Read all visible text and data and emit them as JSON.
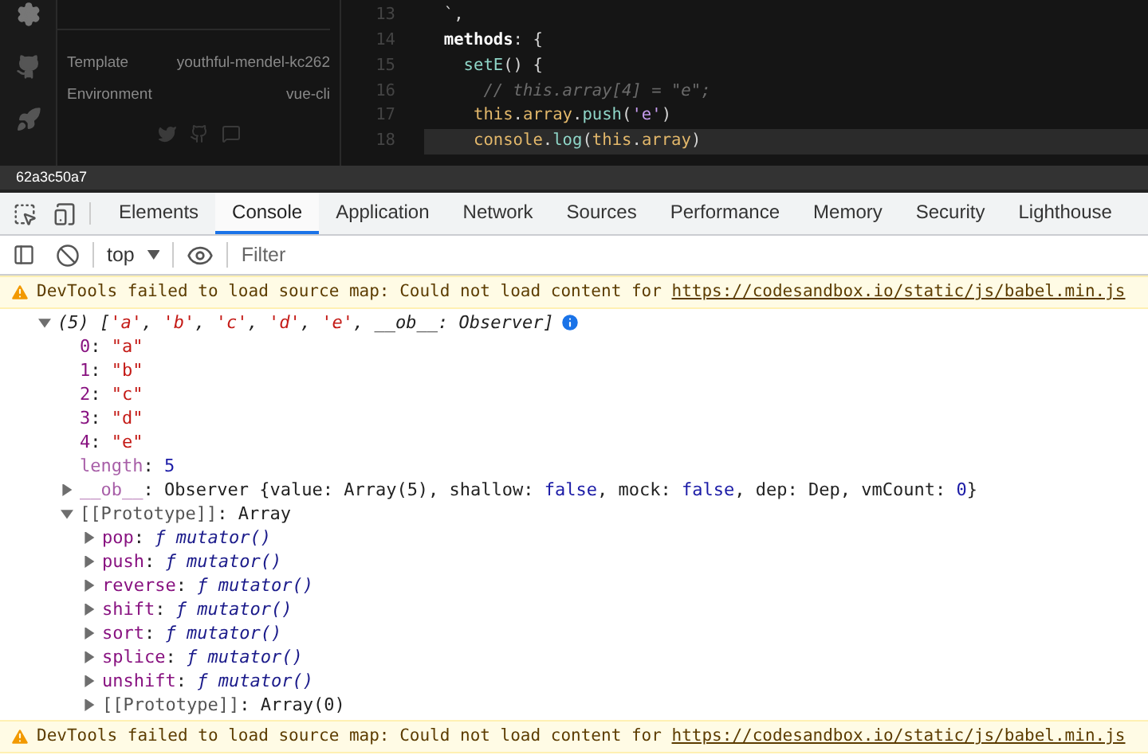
{
  "sidebar": {
    "info": [
      {
        "label": "Template",
        "value": "youthful-mendel-kc262"
      },
      {
        "label": "Environment",
        "value": "vue-cli"
      }
    ]
  },
  "editor": {
    "lines": [
      {
        "number": "13",
        "current": false,
        "tokens": [
          {
            "kind": "punct",
            "text": "  `,"
          }
        ]
      },
      {
        "number": "14",
        "current": false,
        "tokens": [
          {
            "kind": "key",
            "text": "  methods"
          },
          {
            "kind": "punct",
            "text": ": {"
          }
        ]
      },
      {
        "number": "15",
        "current": false,
        "tokens": [
          {
            "kind": "fn",
            "text": "    setE"
          },
          {
            "kind": "punct",
            "text": "() {"
          }
        ]
      },
      {
        "number": "16",
        "current": false,
        "tokens": [
          {
            "kind": "comment",
            "text": "      // this.array[4] = \"e\";"
          }
        ]
      },
      {
        "number": "17",
        "current": false,
        "tokens": [
          {
            "kind": "this",
            "text": "     this"
          },
          {
            "kind": "punct",
            "text": "."
          },
          {
            "kind": "this",
            "text": "array"
          },
          {
            "kind": "punct",
            "text": "."
          },
          {
            "kind": "fn",
            "text": "push"
          },
          {
            "kind": "punct",
            "text": "("
          },
          {
            "kind": "str",
            "text": "'e'"
          },
          {
            "kind": "punct",
            "text": ")"
          }
        ]
      },
      {
        "number": "18",
        "current": true,
        "tokens": [
          {
            "kind": "this",
            "text": "     console"
          },
          {
            "kind": "punct",
            "text": "."
          },
          {
            "kind": "fn",
            "text": "log"
          },
          {
            "kind": "punct",
            "text": "("
          },
          {
            "kind": "this",
            "text": "this"
          },
          {
            "kind": "punct",
            "text": "."
          },
          {
            "kind": "this",
            "text": "array"
          },
          {
            "kind": "punct",
            "text": ")"
          }
        ]
      }
    ]
  },
  "status_bar": {
    "commit": "62a3c50a7"
  },
  "devtools": {
    "tabs": [
      {
        "label": "Elements",
        "selected": false
      },
      {
        "label": "Console",
        "selected": true
      },
      {
        "label": "Application",
        "selected": false
      },
      {
        "label": "Network",
        "selected": false
      },
      {
        "label": "Sources",
        "selected": false
      },
      {
        "label": "Performance",
        "selected": false
      },
      {
        "label": "Memory",
        "selected": false
      },
      {
        "label": "Security",
        "selected": false
      },
      {
        "label": "Lighthouse",
        "selected": false
      }
    ],
    "context": "top",
    "filter": {
      "placeholder": "Filter"
    }
  },
  "console": [
    {
      "kind": "warning",
      "text": "DevTools failed to load source map: Could not load content for ",
      "link": "https://codesandbox.io/static/js/babel.min.js"
    },
    {
      "kind": "tree",
      "root": {
        "expanded": true,
        "info": true,
        "tokens": [
          {
            "kind": "prev",
            "text": "(5) ["
          },
          {
            "kind": "prevstr",
            "text": "'a'"
          },
          {
            "kind": "prev",
            "text": ", "
          },
          {
            "kind": "prevstr",
            "text": "'b'"
          },
          {
            "kind": "prev",
            "text": ", "
          },
          {
            "kind": "prevstr",
            "text": "'c'"
          },
          {
            "kind": "prev",
            "text": ", "
          },
          {
            "kind": "prevstr",
            "text": "'d'"
          },
          {
            "kind": "prev",
            "text": ", "
          },
          {
            "kind": "prevstr",
            "text": "'e'"
          },
          {
            "kind": "prev",
            "text": ", __ob__: Observer]"
          }
        ],
        "children": [
          {
            "tokens": [
              {
                "kind": "name",
                "text": "0"
              },
              {
                "kind": "plain",
                "text": ": "
              },
              {
                "kind": "str",
                "text": "\"a\""
              }
            ]
          },
          {
            "tokens": [
              {
                "kind": "name",
                "text": "1"
              },
              {
                "kind": "plain",
                "text": ": "
              },
              {
                "kind": "str",
                "text": "\"b\""
              }
            ]
          },
          {
            "tokens": [
              {
                "kind": "name",
                "text": "2"
              },
              {
                "kind": "plain",
                "text": ": "
              },
              {
                "kind": "str",
                "text": "\"c\""
              }
            ]
          },
          {
            "tokens": [
              {
                "kind": "name",
                "text": "3"
              },
              {
                "kind": "plain",
                "text": ": "
              },
              {
                "kind": "str",
                "text": "\"d\""
              }
            ]
          },
          {
            "tokens": [
              {
                "kind": "name",
                "text": "4"
              },
              {
                "kind": "plain",
                "text": ": "
              },
              {
                "kind": "str",
                "text": "\"e\""
              }
            ]
          },
          {
            "tokens": [
              {
                "kind": "dimname",
                "text": "length"
              },
              {
                "kind": "plain",
                "text": ": "
              },
              {
                "kind": "num",
                "text": "5"
              }
            ]
          },
          {
            "expanded": false,
            "tokens": [
              {
                "kind": "dimname",
                "text": "__ob__"
              },
              {
                "kind": "plain",
                "text": ": Observer {value: Array(5), shallow: "
              },
              {
                "kind": "num",
                "text": "false"
              },
              {
                "kind": "plain",
                "text": ", mock: "
              },
              {
                "kind": "num",
                "text": "false"
              },
              {
                "kind": "plain",
                "text": ", dep: Dep, vmCount: "
              },
              {
                "kind": "num",
                "text": "0"
              },
              {
                "kind": "plain",
                "text": "}"
              }
            ]
          },
          {
            "expanded": true,
            "tokens": [
              {
                "kind": "gray",
                "text": "[[Prototype]]"
              },
              {
                "kind": "plain",
                "text": ": Array"
              }
            ],
            "children": [
              {
                "expanded": false,
                "tokens": [
                  {
                    "kind": "name",
                    "text": "pop"
                  },
                  {
                    "kind": "plain",
                    "text": ": "
                  },
                  {
                    "kind": "fn",
                    "text": "ƒ mutator()"
                  }
                ]
              },
              {
                "expanded": false,
                "tokens": [
                  {
                    "kind": "name",
                    "text": "push"
                  },
                  {
                    "kind": "plain",
                    "text": ": "
                  },
                  {
                    "kind": "fn",
                    "text": "ƒ mutator()"
                  }
                ]
              },
              {
                "expanded": false,
                "tokens": [
                  {
                    "kind": "name",
                    "text": "reverse"
                  },
                  {
                    "kind": "plain",
                    "text": ": "
                  },
                  {
                    "kind": "fn",
                    "text": "ƒ mutator()"
                  }
                ]
              },
              {
                "expanded": false,
                "tokens": [
                  {
                    "kind": "name",
                    "text": "shift"
                  },
                  {
                    "kind": "plain",
                    "text": ": "
                  },
                  {
                    "kind": "fn",
                    "text": "ƒ mutator()"
                  }
                ]
              },
              {
                "expanded": false,
                "tokens": [
                  {
                    "kind": "name",
                    "text": "sort"
                  },
                  {
                    "kind": "plain",
                    "text": ": "
                  },
                  {
                    "kind": "fn",
                    "text": "ƒ mutator()"
                  }
                ]
              },
              {
                "expanded": false,
                "tokens": [
                  {
                    "kind": "name",
                    "text": "splice"
                  },
                  {
                    "kind": "plain",
                    "text": ": "
                  },
                  {
                    "kind": "fn",
                    "text": "ƒ mutator()"
                  }
                ]
              },
              {
                "expanded": false,
                "tokens": [
                  {
                    "kind": "name",
                    "text": "unshift"
                  },
                  {
                    "kind": "plain",
                    "text": ": "
                  },
                  {
                    "kind": "fn",
                    "text": "ƒ mutator()"
                  }
                ]
              },
              {
                "expanded": false,
                "tokens": [
                  {
                    "kind": "gray",
                    "text": "[[Prototype]]"
                  },
                  {
                    "kind": "plain",
                    "text": ": Array(0)"
                  }
                ]
              }
            ]
          }
        ]
      }
    },
    {
      "kind": "warning",
      "text": "DevTools failed to load source map: Could not load content for ",
      "link": "https://codesandbox.io/static/js/babel.min.js"
    }
  ]
}
